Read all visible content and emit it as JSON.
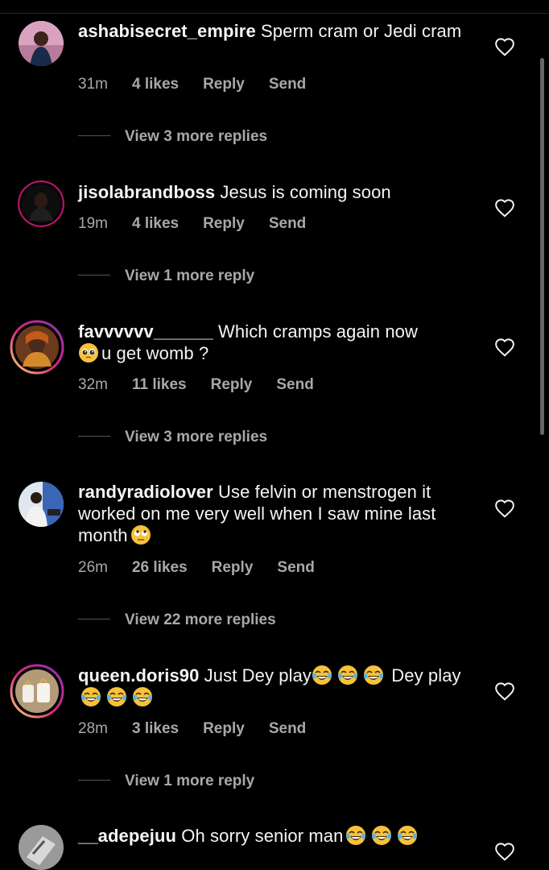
{
  "comments": [
    {
      "username": "ashabisecret_empire",
      "text_parts": [
        " Sperm cram or Jedi cram"
      ],
      "time": "31m",
      "likes": "4 likes",
      "reply": "Reply",
      "send": "Send",
      "view_replies": "View 3 more replies"
    },
    {
      "username": "jisolabrandboss",
      "text_parts": [
        " Jesus is coming soon"
      ],
      "time": "19m",
      "likes": "4 likes",
      "reply": "Reply",
      "send": "Send",
      "view_replies": "View 1 more reply"
    },
    {
      "username": "favvvvvv______",
      "text_parts": [
        " Which cramps again now",
        "u get womb ?"
      ],
      "time": "32m",
      "likes": "11 likes",
      "reply": "Reply",
      "send": "Send",
      "view_replies": "View 3 more replies"
    },
    {
      "username": "randyradiolover",
      "text_parts": [
        " Use felvin or menstrogen it worked on me very well when I saw mine last month"
      ],
      "time": "26m",
      "likes": "26 likes",
      "reply": "Reply",
      "send": "Send",
      "view_replies": "View 22 more replies"
    },
    {
      "username": "queen.doris90",
      "text_parts": [
        " Just Dey play",
        " Dey play"
      ],
      "time": "28m",
      "likes": "3 likes",
      "reply": "Reply",
      "send": "Send",
      "view_replies": "View 1 more reply"
    },
    {
      "username": "__adepejuu",
      "text_parts": [
        " Oh sorry senior man"
      ]
    }
  ],
  "icons": {
    "like": "heart-outline-icon",
    "emoji_pleading": "pleading-face-icon",
    "emoji_eyeroll": "face-rolling-eyes-icon",
    "emoji_laugh": "face-with-tears-of-joy-icon"
  },
  "colors": {
    "background": "#000000",
    "primary_text": "#f5f5f5",
    "secondary_text": "#a8a8a8",
    "story_ring": "#e1306c"
  }
}
